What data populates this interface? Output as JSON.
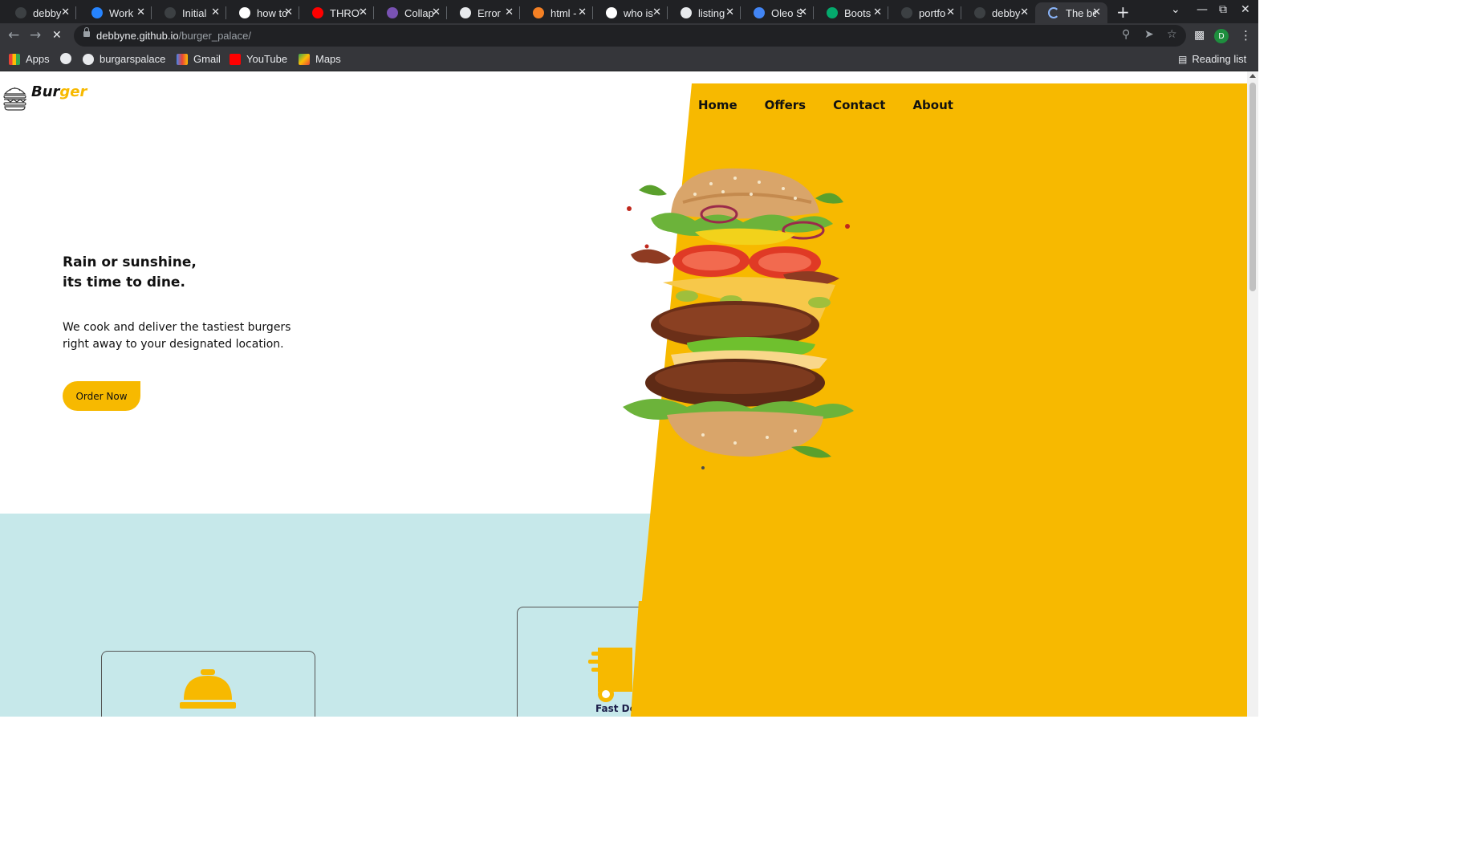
{
  "browser": {
    "tabs": [
      {
        "title": "debby",
        "icon": "github-icon",
        "color": "#3c4043"
      },
      {
        "title": "Work",
        "icon": "atlassian-icon",
        "color": "#2684ff"
      },
      {
        "title": "Initial",
        "icon": "github-icon",
        "color": "#3c4043"
      },
      {
        "title": "how to",
        "icon": "google-icon",
        "color": "#ffffff"
      },
      {
        "title": "THROW",
        "icon": "youtube-icon",
        "color": "#ff0000"
      },
      {
        "title": "Collap",
        "icon": "bootstrap-icon",
        "color": "#7952b3"
      },
      {
        "title": "Error",
        "icon": "globe-icon",
        "color": "#e8eaed"
      },
      {
        "title": "html -",
        "icon": "stackoverflow-icon",
        "color": "#f48024"
      },
      {
        "title": "who is",
        "icon": "google-icon",
        "color": "#ffffff"
      },
      {
        "title": "listing",
        "icon": "globe-icon",
        "color": "#e8eaed"
      },
      {
        "title": "Oleo S",
        "icon": "google-fonts-icon",
        "color": "#4285f4"
      },
      {
        "title": "Boots",
        "icon": "w3schools-icon",
        "color": "#04aa6d"
      },
      {
        "title": "portfo",
        "icon": "github-icon",
        "color": "#3c4043"
      },
      {
        "title": "debby",
        "icon": "github-icon",
        "color": "#3c4043"
      },
      {
        "title": "The be",
        "icon": "loading-icon",
        "color": "#8ab4f8",
        "active": true
      }
    ],
    "url_domain": "debbyne.github.io",
    "url_path": "/burger_palace/",
    "profile_initial": "D",
    "bookmarks": [
      {
        "label": "Apps",
        "icon": "apps-grid-icon"
      },
      {
        "label": "",
        "icon": "globe-icon"
      },
      {
        "label": "burgarspalace",
        "icon": "github-icon"
      },
      {
        "label": "Gmail",
        "icon": "gmail-icon"
      },
      {
        "label": "YouTube",
        "icon": "youtube-icon"
      },
      {
        "label": "Maps",
        "icon": "maps-icon"
      }
    ],
    "reading_list": "Reading list"
  },
  "site": {
    "logo_part1": "Bur",
    "logo_part2": "ger",
    "nav": [
      "Home",
      "Offers",
      "Contact",
      "About"
    ],
    "hero_heading_line1": "Rain or sunshine,",
    "hero_heading_line2": "its time to dine.",
    "hero_copy_line1": "We cook and deliver the tastiest burgers",
    "hero_copy_line2": "right away to your designated location.",
    "order_button": "Order Now",
    "service_card2_label": "Fast De",
    "colors": {
      "accent": "#f7b900",
      "services_bg": "#c6e8ea",
      "text": "#111111"
    }
  }
}
